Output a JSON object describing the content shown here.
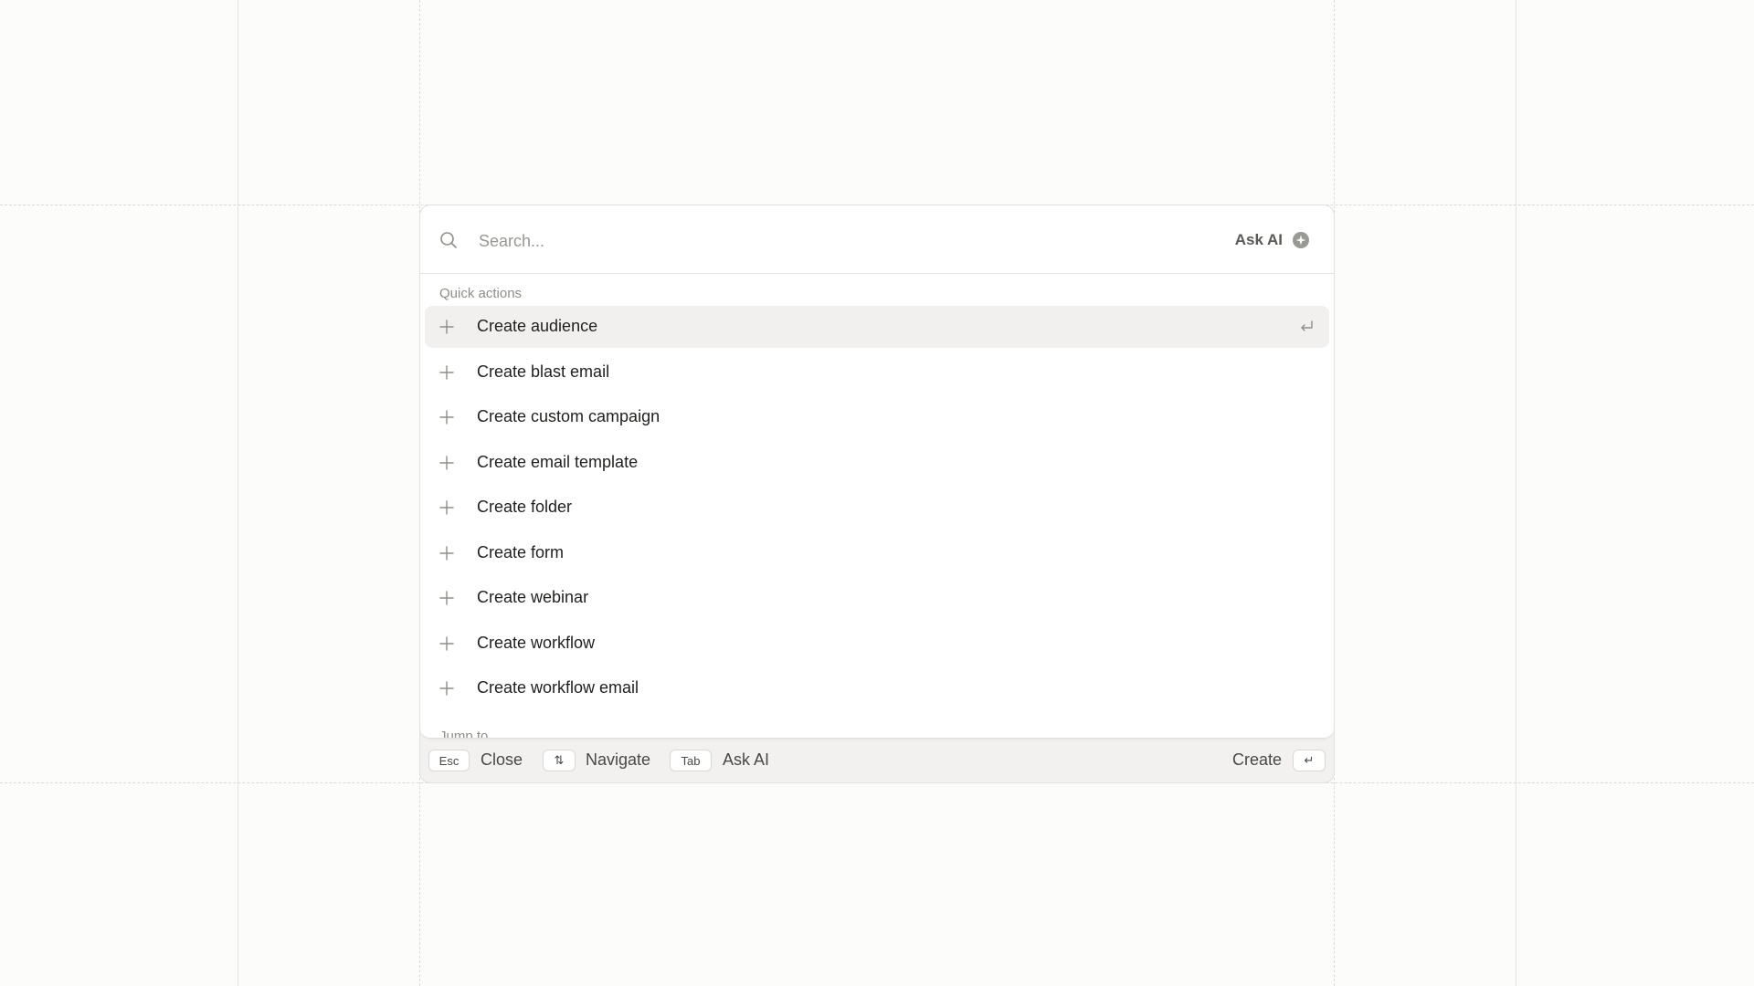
{
  "search": {
    "placeholder": "Search...",
    "ask_ai_label": "Ask AI"
  },
  "sections": {
    "quick_actions_label": "Quick actions",
    "jump_to_label": "Jump to"
  },
  "quick_actions": [
    {
      "label": "Create audience"
    },
    {
      "label": "Create blast email"
    },
    {
      "label": "Create custom campaign"
    },
    {
      "label": "Create email template"
    },
    {
      "label": "Create folder"
    },
    {
      "label": "Create form"
    },
    {
      "label": "Create webinar"
    },
    {
      "label": "Create workflow"
    },
    {
      "label": "Create workflow email"
    }
  ],
  "footer": {
    "esc_key": "Esc",
    "close_label": "Close",
    "navigate_key": "⇅",
    "navigate_label": "Navigate",
    "tab_key": "Tab",
    "ask_ai_label": "Ask AI",
    "create_label": "Create",
    "enter_key": "↵"
  },
  "icons": {
    "search": "search-icon",
    "ask_ai": "sparkle-icon",
    "item": "plus-icon",
    "selected_item_hint": "enter-icon"
  },
  "colors": {
    "background": "#fcfcfb",
    "panel": "#ffffff",
    "footer_bg": "#f2f1ef",
    "active_row": "#f1f0ee",
    "muted_text": "#8f8d88"
  }
}
